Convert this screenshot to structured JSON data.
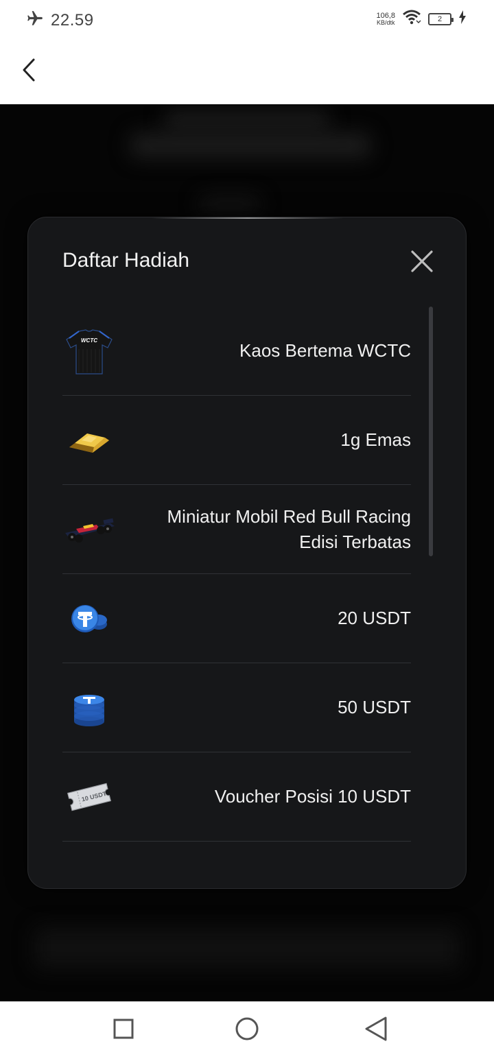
{
  "status_bar": {
    "time": "22.59",
    "net_speed_value": "106,8",
    "net_speed_unit": "KB/dtk",
    "battery_level": "2",
    "icons": [
      "airplane-icon",
      "wifi-icon",
      "battery-icon",
      "charging-icon"
    ]
  },
  "header": {
    "back_icon": "chevron-left-icon"
  },
  "modal": {
    "title": "Daftar Hadiah",
    "close_icon": "close-icon",
    "items": [
      {
        "label": "Kaos Bertema WCTC",
        "icon": "tshirt-icon",
        "thumb_text": "WCTC"
      },
      {
        "label": "1g Emas",
        "icon": "gold-bar-icon"
      },
      {
        "label_line1": "Miniatur Mobil Red Bull Racing",
        "label_line2": "Edisi Terbatas",
        "icon": "race-car-icon"
      },
      {
        "label": "20 USDT",
        "icon": "usdt-coins-icon"
      },
      {
        "label": "50 USDT",
        "icon": "usdt-coin-stack-icon"
      },
      {
        "label": "Voucher Posisi 10 USDT",
        "icon": "voucher-ticket-icon",
        "thumb_text": "10 USDT"
      }
    ]
  },
  "nav_bar": {
    "buttons": [
      "recent-apps-icon",
      "home-icon",
      "back-triangle-icon"
    ]
  },
  "colors": {
    "modal_bg": "#161719",
    "backdrop": "#050505",
    "text": "#f0f0f0",
    "usdt_blue": "#2f7be0",
    "gold": "#e3b53b"
  }
}
